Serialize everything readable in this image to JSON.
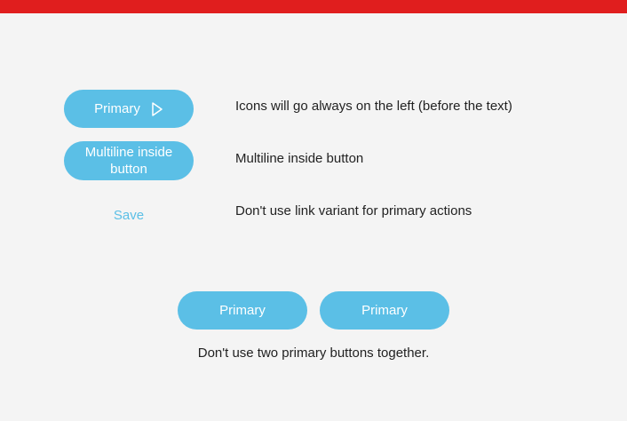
{
  "colors": {
    "top_bar": "#e01e1e",
    "primary": "#5bbfe6",
    "link": "#5bbfe6",
    "background": "#f4f4f4"
  },
  "examples": {
    "primary_with_icon": {
      "label": "Primary",
      "icon": "play-outline-icon"
    },
    "multiline": {
      "label": "Multiline inside\nbutton"
    },
    "link_save": {
      "label": "Save"
    }
  },
  "notes": {
    "icons": "Icons will go always on the left (before the text)",
    "multiline": "Multiline inside button",
    "link_variant": "Don't use link variant for primary actions"
  },
  "pair": {
    "first_label": "Primary",
    "second_label": "Primary",
    "caption": "Don't use two primary buttons together."
  }
}
